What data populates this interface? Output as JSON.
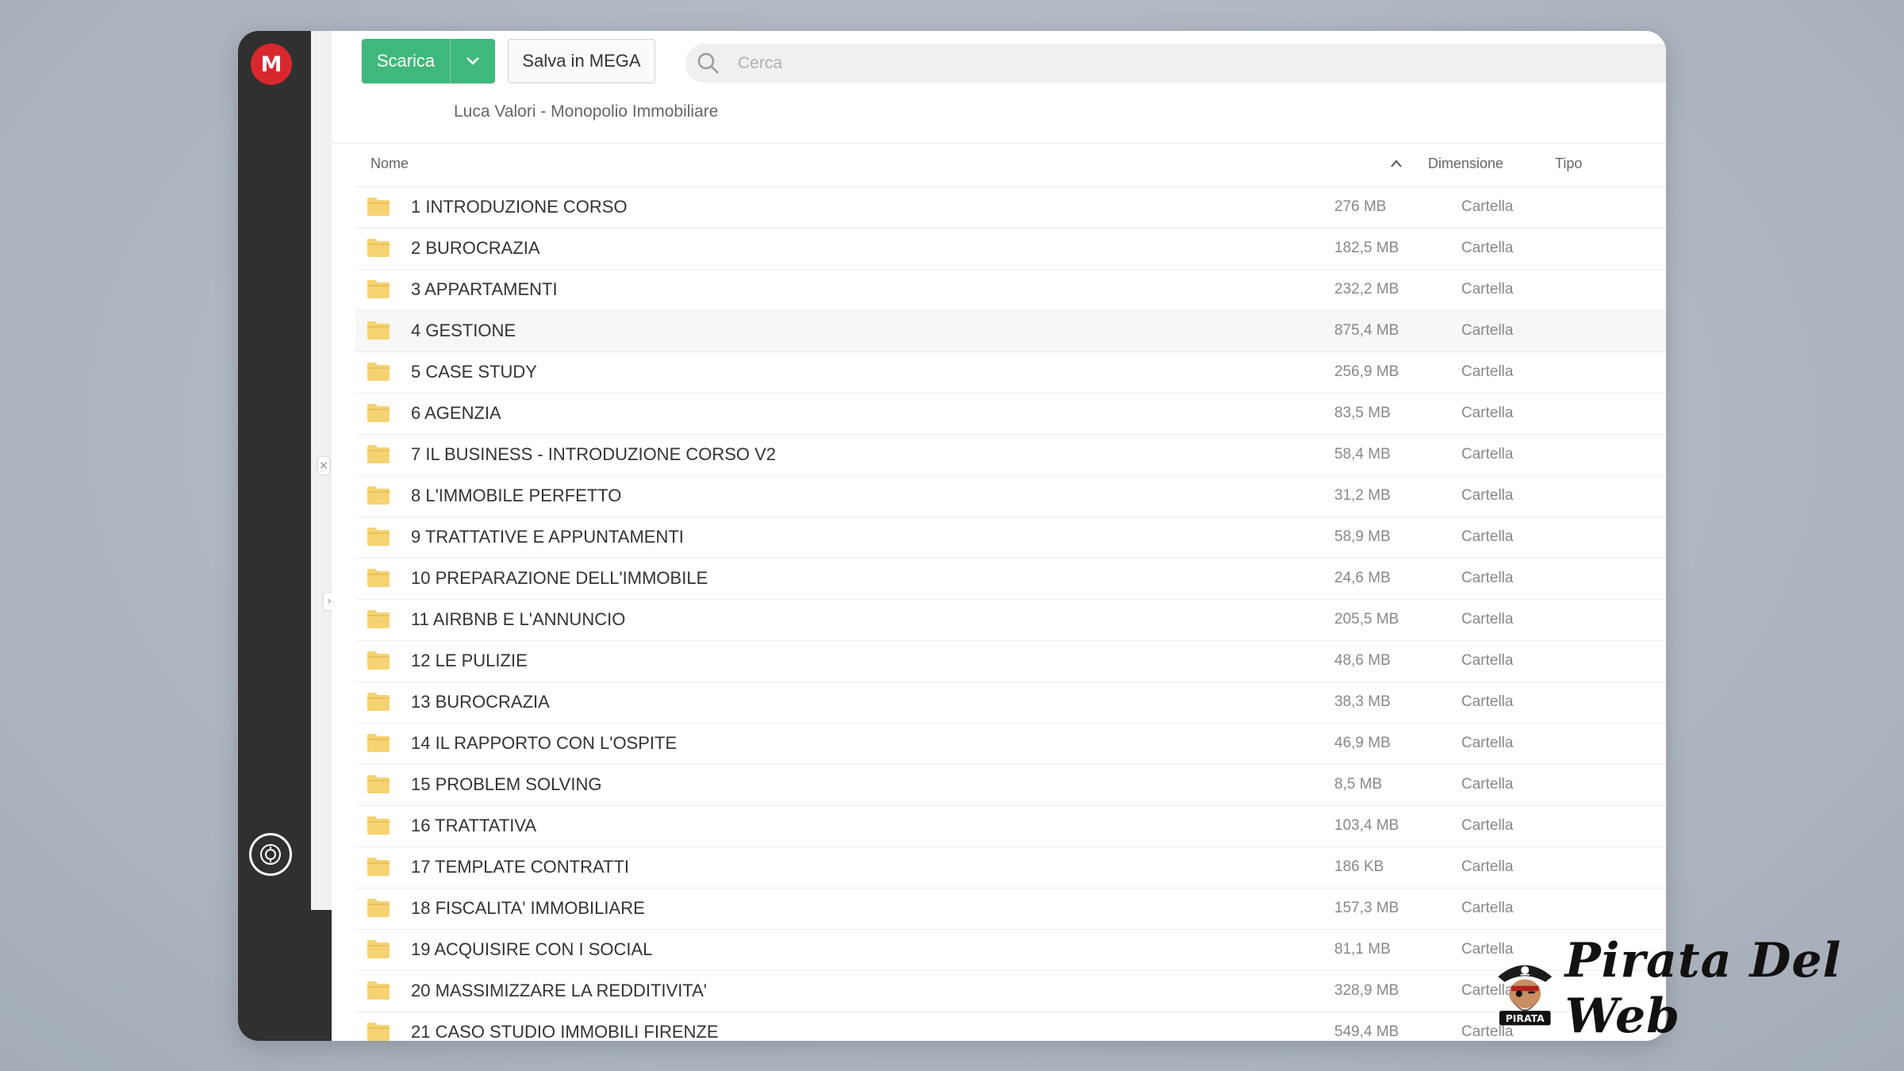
{
  "app": {
    "logo_letter": "M"
  },
  "toolbar": {
    "download_label": "Scarica",
    "save_label": "Salva in MEGA",
    "search_placeholder": "Cerca"
  },
  "breadcrumb": {
    "path": "Luca Valori - Monopolio Immobiliare"
  },
  "columns": {
    "name": "Nome",
    "size": "Dimensione",
    "type": "Tipo"
  },
  "files": [
    {
      "name": "1 INTRODUZIONE CORSO",
      "size": "276 MB",
      "type": "Cartella"
    },
    {
      "name": "2 BUROCRAZIA",
      "size": "182,5 MB",
      "type": "Cartella"
    },
    {
      "name": "3 APPARTAMENTI",
      "size": "232,2 MB",
      "type": "Cartella"
    },
    {
      "name": "4 GESTIONE",
      "size": "875,4 MB",
      "type": "Cartella"
    },
    {
      "name": "5 CASE STUDY",
      "size": "256,9 MB",
      "type": "Cartella"
    },
    {
      "name": "6 AGENZIA",
      "size": "83,5 MB",
      "type": "Cartella"
    },
    {
      "name": "7 IL BUSINESS - INTRODUZIONE CORSO V2",
      "size": "58,4 MB",
      "type": "Cartella"
    },
    {
      "name": "8 L'IMMOBILE PERFETTO",
      "size": "31,2 MB",
      "type": "Cartella"
    },
    {
      "name": "9 TRATTATIVE E APPUNTAMENTI",
      "size": "58,9 MB",
      "type": "Cartella"
    },
    {
      "name": "10 PREPARAZIONE DELL'IMMOBILE",
      "size": "24,6 MB",
      "type": "Cartella"
    },
    {
      "name": "11 AIRBNB E L'ANNUNCIO",
      "size": "205,5 MB",
      "type": "Cartella"
    },
    {
      "name": "12 LE PULIZIE",
      "size": "48,6 MB",
      "type": "Cartella"
    },
    {
      "name": "13 BUROCRAZIA",
      "size": "38,3 MB",
      "type": "Cartella"
    },
    {
      "name": "14 IL RAPPORTO CON L'OSPITE",
      "size": "46,9 MB",
      "type": "Cartella"
    },
    {
      "name": "15 PROBLEM SOLVING",
      "size": "8,5 MB",
      "type": "Cartella"
    },
    {
      "name": "16 TRATTATIVA",
      "size": "103,4 MB",
      "type": "Cartella"
    },
    {
      "name": "17 TEMPLATE CONTRATTI",
      "size": "186 KB",
      "type": "Cartella"
    },
    {
      "name": "18 FISCALITA' IMMOBILIARE",
      "size": "157,3 MB",
      "type": "Cartella"
    },
    {
      "name": "19 ACQUISIRE CON I SOCIAL",
      "size": "81,1 MB",
      "type": "Cartella"
    },
    {
      "name": "20 MASSIMIZZARE LA REDDITIVITA'",
      "size": "328,9 MB",
      "type": "Cartella"
    },
    {
      "name": "21 CASO STUDIO IMMOBILI FIRENZE",
      "size": "549,4 MB",
      "type": "Cartella"
    }
  ],
  "watermark": {
    "brand_text": "Pirata Del Web",
    "badge_text": "PIRATA"
  },
  "colors": {
    "accent_green": "#3fb87b",
    "logo_red": "#d9272e",
    "sidebar_dark": "#303030",
    "folder_yellow": "#f5d373"
  }
}
